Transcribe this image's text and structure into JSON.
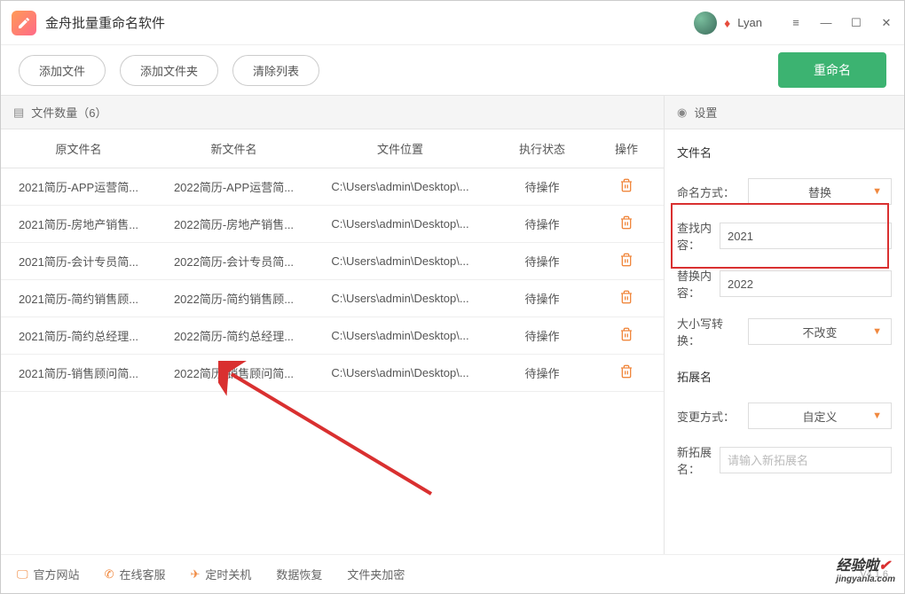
{
  "app": {
    "title": "金舟批量重命名软件",
    "user": "Lyan"
  },
  "toolbar": {
    "add_file": "添加文件",
    "add_folder": "添加文件夹",
    "clear_list": "清除列表",
    "rename": "重命名"
  },
  "left": {
    "header": "文件数量（6）"
  },
  "columns": {
    "old": "原文件名",
    "new": "新文件名",
    "path": "文件位置",
    "status": "执行状态",
    "op": "操作"
  },
  "rows": [
    {
      "old": "2021简历-APP运营简...",
      "new": "2022简历-APP运营简...",
      "path": "C:\\Users\\admin\\Desktop\\...",
      "status": "待操作"
    },
    {
      "old": "2021简历-房地产销售...",
      "new": "2022简历-房地产销售...",
      "path": "C:\\Users\\admin\\Desktop\\...",
      "status": "待操作"
    },
    {
      "old": "2021简历-会计专员简...",
      "new": "2022简历-会计专员简...",
      "path": "C:\\Users\\admin\\Desktop\\...",
      "status": "待操作"
    },
    {
      "old": "2021简历-简约销售顾...",
      "new": "2022简历-简约销售顾...",
      "path": "C:\\Users\\admin\\Desktop\\...",
      "status": "待操作"
    },
    {
      "old": "2021简历-简约总经理...",
      "new": "2022简历-简约总经理...",
      "path": "C:\\Users\\admin\\Desktop\\...",
      "status": "待操作"
    },
    {
      "old": "2021简历-销售顾问简...",
      "new": "2022简历-销售顾问简...",
      "path": "C:\\Users\\admin\\Desktop\\...",
      "status": "待操作"
    }
  ],
  "settings": {
    "header": "设置",
    "filename_section": "文件名",
    "naming_label": "命名方式：",
    "naming_value": "替换",
    "find_label": "查找内容：",
    "find_value": "2021",
    "replace_label": "替换内容：",
    "replace_value": "2022",
    "case_label": "大小写转换：",
    "case_value": "不改变",
    "ext_section": "拓展名",
    "ext_mode_label": "变更方式：",
    "ext_mode_value": "自定义",
    "ext_new_label": "新拓展名：",
    "ext_new_placeholder": "请输入新拓展名"
  },
  "footer": {
    "site": "官方网站",
    "service": "在线客服",
    "timer": "定时关机",
    "recover": "数据恢复",
    "encrypt": "文件夹加密",
    "version": "V4.1.6"
  },
  "watermark": {
    "main": "经验啦",
    "sub": "jingyanla.com"
  }
}
